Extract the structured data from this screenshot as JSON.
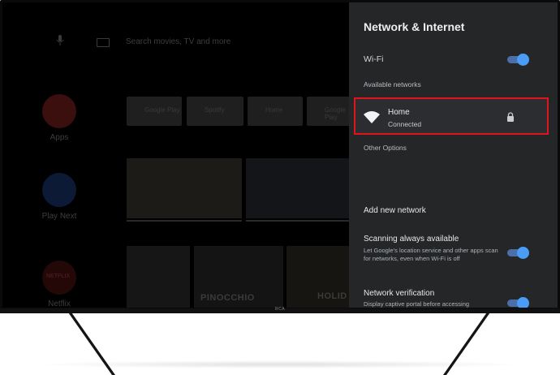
{
  "home": {
    "search_placeholder": "Search movies, TV and more",
    "rail": [
      {
        "label": "Apps"
      },
      {
        "label": "Play Next"
      },
      {
        "label": "Netflix",
        "badge": "NETFLIX"
      }
    ],
    "app_tiles": [
      "Google Play",
      "Spotify",
      "Home",
      "Google Play"
    ],
    "posters": [
      "PINOCCHIO",
      "HOLID"
    ]
  },
  "tv": {
    "brand": "RCA"
  },
  "panel": {
    "title": "Network & Internet",
    "wifi_label": "Wi-Fi",
    "wifi_on": true,
    "available_networks_header": "Available networks",
    "networks": [
      {
        "name": "Home",
        "status": "Connected",
        "secured": true
      }
    ],
    "other_options_header": "Other Options",
    "add_network_label": "Add new network",
    "scanning": {
      "title": "Scanning always available",
      "description": "Let Google's location service and other apps scan for networks, even when Wi-Fi is off",
      "on": true
    },
    "verification": {
      "title": "Network verification",
      "description": "Display captive portal before accessing",
      "on": true
    }
  },
  "colors": {
    "highlight_border": "#e3131b",
    "toggle_accent": "#4a9cf7",
    "panel_bg": "#242628"
  }
}
